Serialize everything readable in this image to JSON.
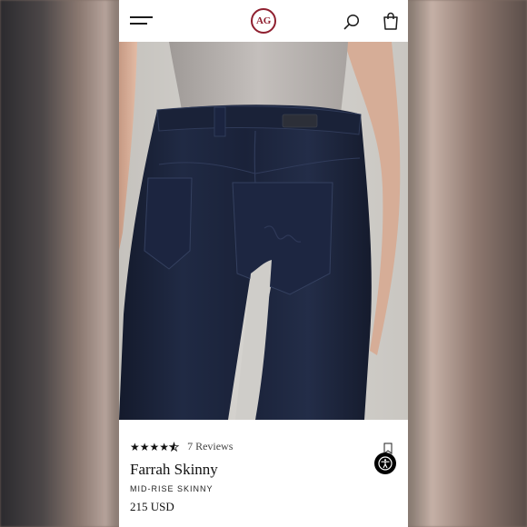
{
  "header": {
    "logo_text": "AG",
    "menu_icon": "hamburger-menu-icon",
    "search_icon": "search-icon",
    "bag_icon": "shopping-bag-icon",
    "brand_color": "#8f1f2f"
  },
  "product_image": {
    "alt": "Farrah Skinny jeans back view"
  },
  "product": {
    "rating": 4.5,
    "rating_max": 5,
    "reviews_label": "7 Reviews",
    "name": "Farrah Skinny",
    "subtitle": "MID-RISE SKINNY",
    "price": "215 USD"
  },
  "actions": {
    "wishlist_icon": "bookmark-icon",
    "accessibility_icon": "accessibility-icon"
  }
}
